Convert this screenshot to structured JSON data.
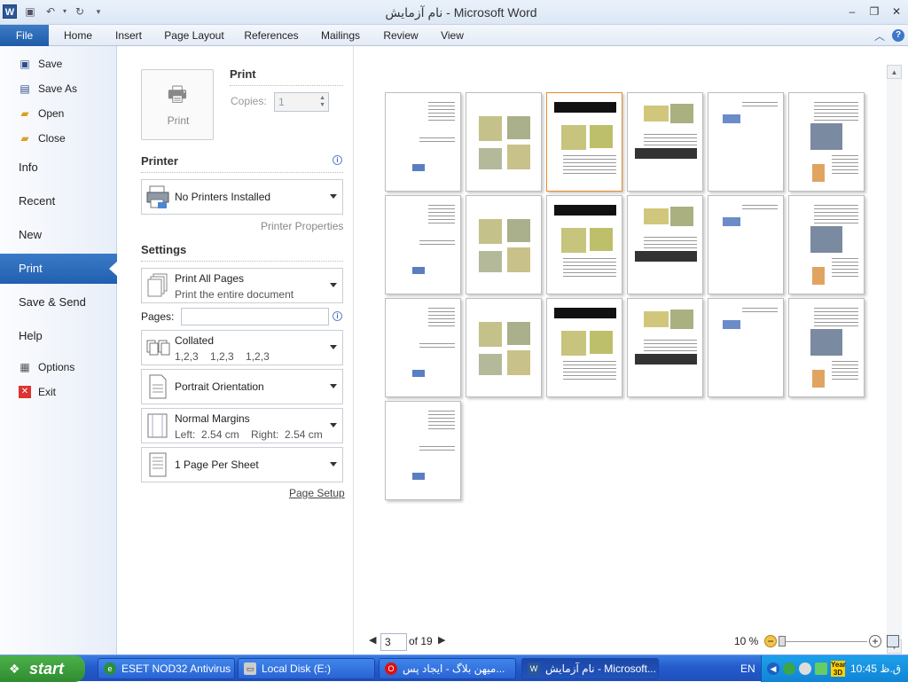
{
  "titlebar": {
    "title": "نام آزمایش  -  Microsoft Word",
    "app_icon": "W",
    "quick_access": [
      "save-icon",
      "undo-icon",
      "redo-icon",
      "customize-icon"
    ],
    "controls": [
      "minimize-icon",
      "restore-icon",
      "close-icon"
    ]
  },
  "ribbon": {
    "file_tab": "File",
    "tabs": [
      "Home",
      "Insert",
      "Page Layout",
      "References",
      "Mailings",
      "Review",
      "View"
    ]
  },
  "backstage": {
    "items": [
      {
        "label": "Save",
        "icon": "save-icon"
      },
      {
        "label": "Save As",
        "icon": "save-as-icon"
      },
      {
        "label": "Open",
        "icon": "open-folder-icon"
      },
      {
        "label": "Close",
        "icon": "close-folder-icon"
      }
    ],
    "big_items": [
      "Info",
      "Recent",
      "New",
      "Print",
      "Save & Send",
      "Help"
    ],
    "selected": "Print",
    "bottom_items": [
      {
        "label": "Options",
        "icon": "options-icon"
      },
      {
        "label": "Exit",
        "icon": "exit-icon"
      }
    ]
  },
  "print_panel": {
    "print_button": "Print",
    "print_heading": "Print",
    "copies_label": "Copies:",
    "copies_value": "1",
    "printer_heading": "Printer",
    "printer_name": "No Printers Installed",
    "printer_properties": "Printer Properties",
    "settings_heading": "Settings",
    "pages_range": {
      "title": "Print All Pages",
      "subtitle": "Print the entire document"
    },
    "pages_label": "Pages:",
    "pages_value": "",
    "collation": {
      "title": "Collated",
      "subtitle": "1,2,3    1,2,3    1,2,3"
    },
    "orientation": "Portrait Orientation",
    "margins": {
      "title": "Normal Margins",
      "subtitle": "Left:  2.54 cm    Right:  2.54 cm"
    },
    "per_sheet": "1 Page Per Sheet",
    "page_setup": "Page Setup"
  },
  "preview": {
    "page_count": 19,
    "current_page_index": 3,
    "page_input": "3",
    "of_label": "of 19",
    "zoom_label": "10 %"
  },
  "taskbar": {
    "start_label": "start",
    "tasks": [
      {
        "label": "ESET NOD32 Antivirus",
        "icon": "eset-icon",
        "active": false
      },
      {
        "label": "Local Disk (E:)",
        "icon": "drive-icon",
        "active": false
      },
      {
        "label": "میهن بلاگ - ایجاد پس...",
        "icon": "opera-icon",
        "active": false
      },
      {
        "label": "نام آزمایش - Microsoft...",
        "icon": "word-icon",
        "active": true
      }
    ],
    "language": "EN",
    "clock": "10:45 ق.ظ"
  }
}
